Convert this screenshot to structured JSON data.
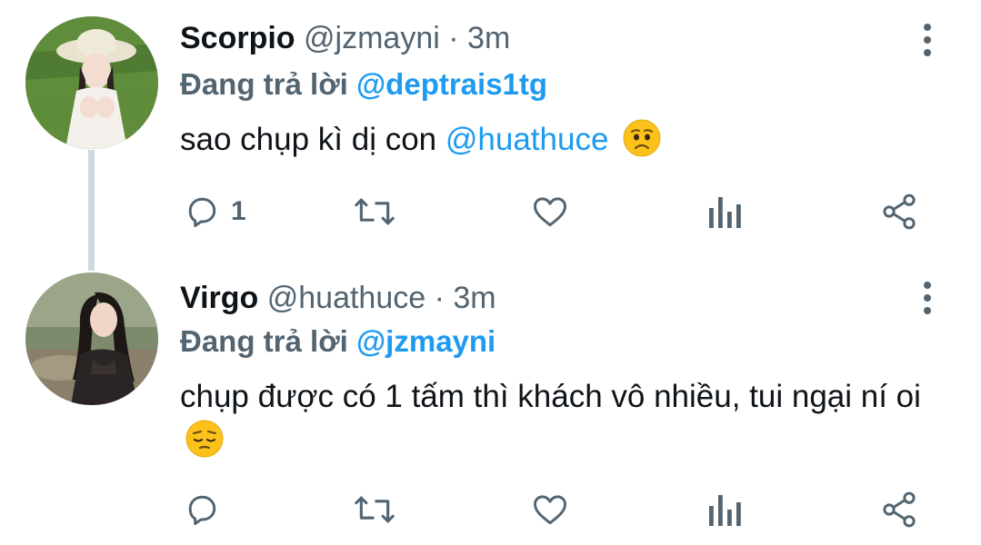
{
  "tweets": [
    {
      "name": "Scorpio",
      "handle": "@jzmayni",
      "separator": "·",
      "time": "3m",
      "reply_prefix": "Đang trả lời",
      "reply_to": "@deptrais1tg",
      "text": "sao chụp kì dị con",
      "mention": "@huathuce",
      "emoji": "worried-face",
      "reply_count": "1"
    },
    {
      "name": "Virgo",
      "handle": "@huathuce",
      "separator": "·",
      "time": "3m",
      "reply_prefix": "Đang trả lời",
      "reply_to": "@jzmayni",
      "text": "chụp được có 1 tấm thì khách vô nhiều, tui ngại ní oi",
      "emoji": "pensive-face",
      "reply_count": ""
    }
  ],
  "colors": {
    "accent": "#1d9bf0",
    "secondary_text": "#536471",
    "thread_line": "#cfd9de"
  }
}
